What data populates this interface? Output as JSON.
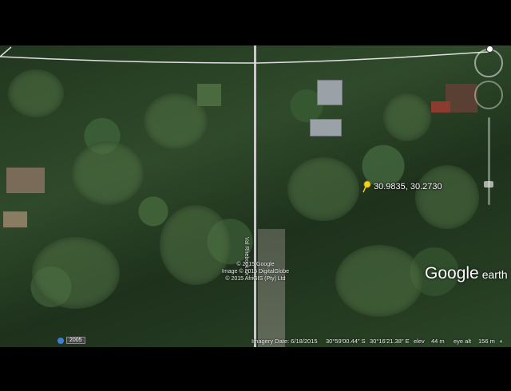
{
  "placemark": {
    "label": "30.9835, 30.2730",
    "icon": "pushpin-icon",
    "color": "#f4d21c"
  },
  "road": {
    "label": "Val Rhebock Dr"
  },
  "attribution": [
    "© 2015 Google",
    "Image © 2015 DigitalGlobe",
    "© 2015 AfriGIS (Pty) Ltd"
  ],
  "brand": {
    "name": "Google",
    "suffix": "earth"
  },
  "historical": {
    "year": "2005"
  },
  "status": {
    "imagery_date": "Imagery Date: 6/18/2015",
    "lat": "30°59'00.44\" S",
    "lon": "30°16'21.38\" E",
    "elev_label": "elev",
    "elev_value": "44 m",
    "eye_label": "eye alt",
    "eye_value": "156 m"
  },
  "colors": {
    "foliage": "#2f4a2a",
    "road": "#d9d9d9"
  }
}
